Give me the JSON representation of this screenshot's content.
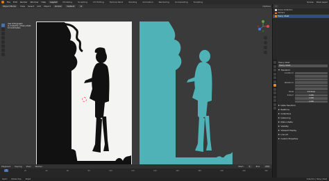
{
  "topbar": {
    "menus": [
      "File",
      "Edit",
      "Render",
      "Window",
      "Help"
    ],
    "workspaces": [
      "Layout",
      "Modeling",
      "Sculpting",
      "UV Editing",
      "Texture Paint",
      "Shading",
      "Animation",
      "Rendering",
      "Compositing",
      "Scripting"
    ],
    "active_workspace": "Layout",
    "scene": "Scene",
    "view_layer": "View Layer"
  },
  "viewport_header": {
    "mode": "Object Mode",
    "view": "View",
    "select": "Select",
    "add": "Add",
    "object": "Object",
    "transform": "Global",
    "snap": "Default",
    "options": "Options"
  },
  "viewport_stats": {
    "line1": "User Orthographic",
    "line2": "(1) Collection | Heavy Abset",
    "line3": "10 Centimeters"
  },
  "outliner": {
    "header": "Scene Collection",
    "rows": [
      {
        "label": "Scene Collection",
        "selected": false,
        "kind": "coll"
      },
      {
        "label": "Camera",
        "selected": false,
        "kind": "obj"
      },
      {
        "label": "Heavy Abset",
        "selected": true,
        "kind": "obj"
      }
    ]
  },
  "properties": {
    "object_name": "Heavy Abset",
    "object_field": "Heavy Abset",
    "sections": {
      "transform": "Transform",
      "delta": "Delta Transform",
      "relations": "Relations",
      "collections": "Collections",
      "instancing": "Instancing",
      "motion_paths": "Motion Paths",
      "visibility": "Visibility",
      "viewport_display": "Viewport Display",
      "line_art": "Line Art",
      "custom_properties": "Custom Properties"
    },
    "location_label": "Location X",
    "rotation_label": "Rotation X",
    "mode_label": "Mode",
    "mode_value": "XYZ Euler",
    "scale_label": "Scale X",
    "scale_values": [
      "1.000",
      "1.000",
      "1.000"
    ]
  },
  "timeline": {
    "menus": [
      "Playback",
      "Keying",
      "View",
      "Marker"
    ],
    "current_frame": "1",
    "ruler": [
      "0",
      "20",
      "40",
      "60",
      "80",
      "100",
      "120",
      "140",
      "160",
      "180",
      "200",
      "220",
      "240"
    ],
    "start": "Start",
    "start_value": "1",
    "end": "End",
    "end_value": "250"
  },
  "statusbar": {
    "left": [
      "Select",
      "Rotate View",
      "Object"
    ],
    "version": "Collection | Heavy Abset"
  },
  "colors": {
    "accent": "#4772b3",
    "teal": "#4fb2b7",
    "orange": "#e38b2e"
  }
}
